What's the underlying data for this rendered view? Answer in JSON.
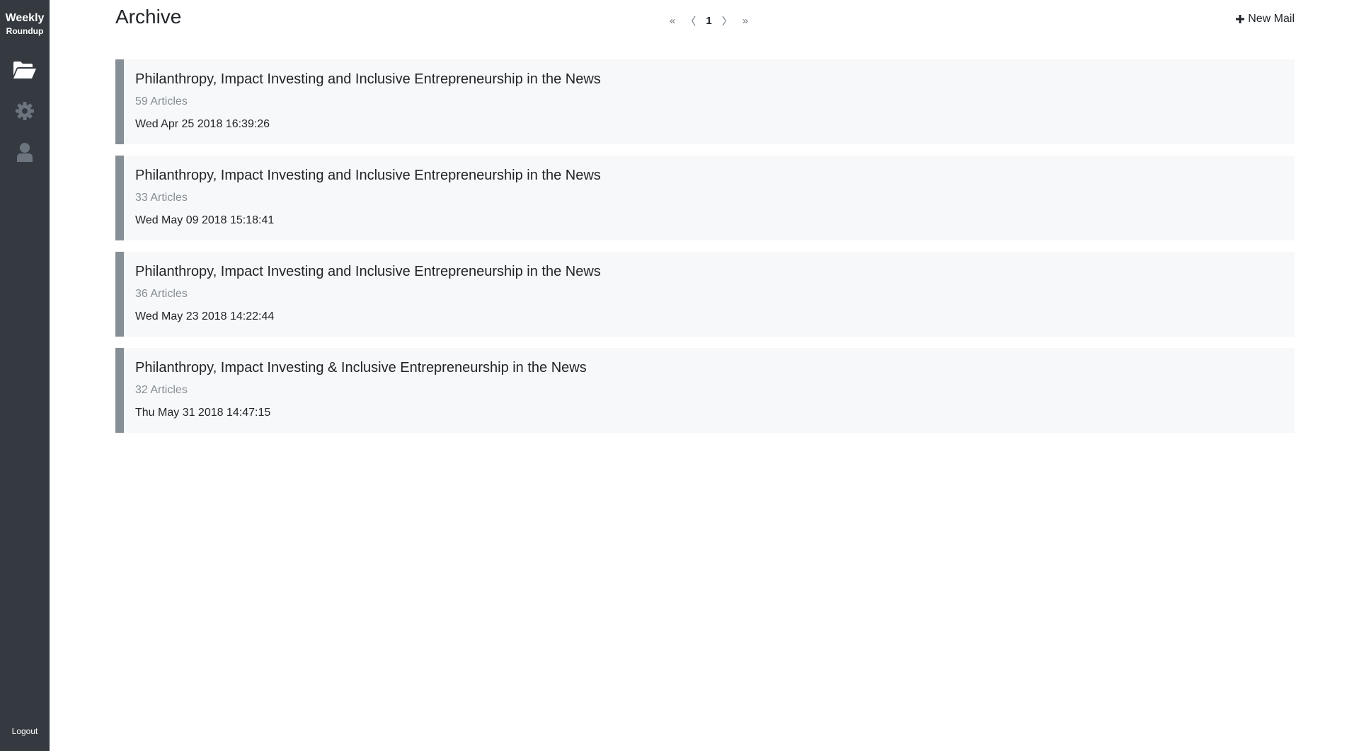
{
  "sidebar": {
    "brand_line1": "Weekly",
    "brand_line2": "Roundup",
    "icons": [
      "folder-open-icon",
      "gear-icon",
      "user-icon"
    ],
    "logout_label": "Logout",
    "color": "#343a40"
  },
  "header": {
    "title": "Archive",
    "pagination": {
      "first": "«",
      "prev": "〈",
      "current": "1",
      "next": "〉",
      "last": "»"
    },
    "new_mail_label": "New Mail"
  },
  "archive": [
    {
      "title": "Philanthropy, Impact Investing and Inclusive Entrepreneurship in the News",
      "count": "59 Articles",
      "date": "Wed Apr 25 2018 16:39:26"
    },
    {
      "title": "Philanthropy, Impact Investing and Inclusive Entrepreneurship in the News",
      "count": "33 Articles",
      "date": "Wed May 09 2018 15:18:41"
    },
    {
      "title": "Philanthropy, Impact Investing and Inclusive Entrepreneurship in the News",
      "count": "36 Articles",
      "date": "Wed May 23 2018 14:22:44"
    },
    {
      "title": "Philanthropy, Impact Investing & Inclusive Entrepreneurship in the News",
      "count": "32 Articles",
      "date": "Thu May 31 2018 14:47:15"
    }
  ],
  "colors": {
    "card_background": "#f7f8f9",
    "card_accent": "#868e96",
    "muted_text": "#868e96"
  }
}
